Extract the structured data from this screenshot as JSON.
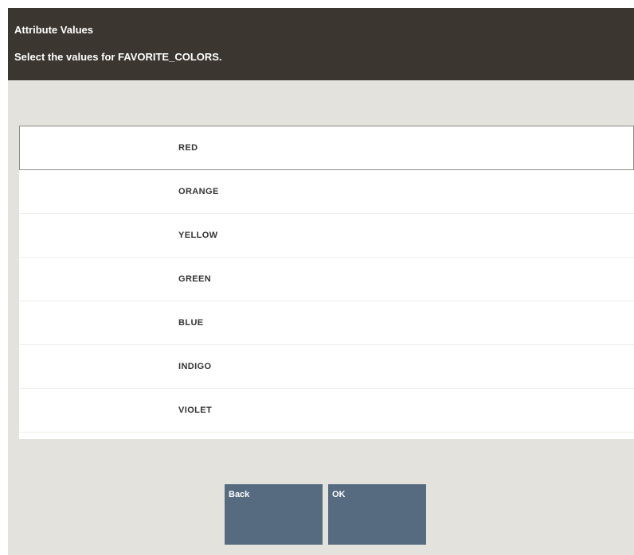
{
  "header": {
    "title": "Attribute Values",
    "subtitle": "Select the values for FAVORITE_COLORS."
  },
  "values": [
    {
      "label": "RED",
      "selected": true
    },
    {
      "label": "ORANGE",
      "selected": false
    },
    {
      "label": "YELLOW",
      "selected": false
    },
    {
      "label": "GREEN",
      "selected": false
    },
    {
      "label": "BLUE",
      "selected": false
    },
    {
      "label": "INDIGO",
      "selected": false
    },
    {
      "label": "VIOLET",
      "selected": false
    }
  ],
  "buttons": {
    "back_label": "Back",
    "ok_label": "OK"
  },
  "colors": {
    "header_bg": "#3b3730",
    "screen_bg": "#e4e2dd",
    "button_bg": "#566b80"
  }
}
